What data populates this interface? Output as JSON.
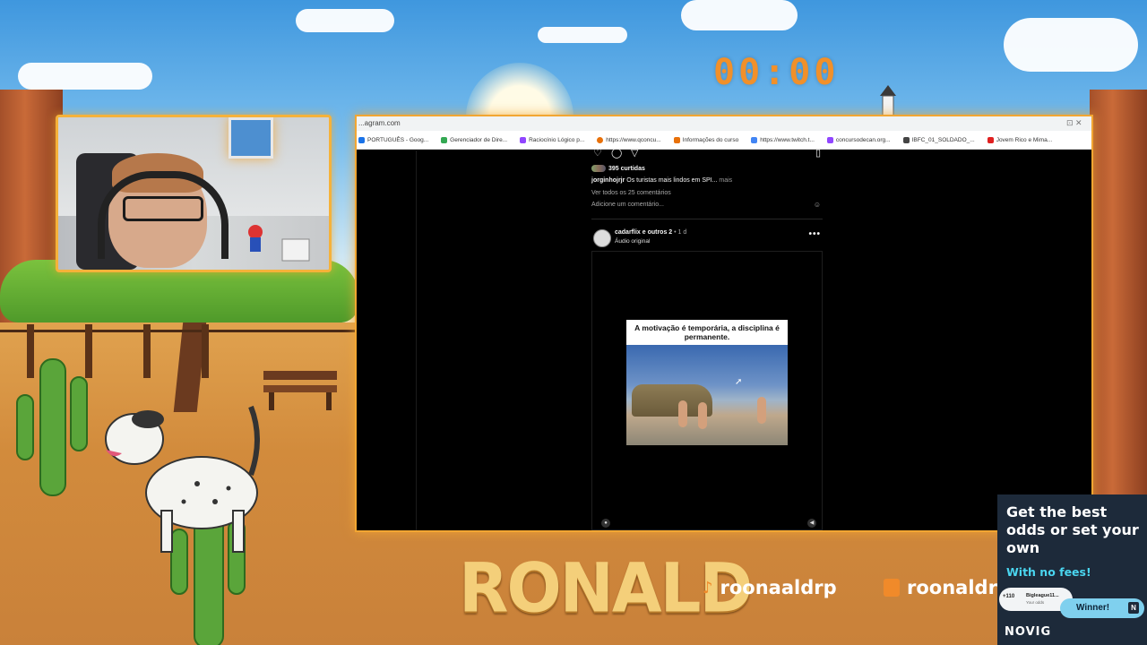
{
  "stream": {
    "timer": "00:00",
    "streamer_name": "RONALD",
    "tiktok_handle": "roonaaldrp",
    "twitch_handle": "roonaldrp"
  },
  "browser": {
    "url": "...agram.com",
    "bookmarks": [
      {
        "label": "PORTUGUÊS - Goog...",
        "color": "#1a73e8"
      },
      {
        "label": "Gerenciador de Dire...",
        "color": "#34a853"
      },
      {
        "label": "Raciocínio Lógico p...",
        "color": "#9146ff"
      },
      {
        "label": "https://www.qconcu...",
        "color": "#e8710a"
      },
      {
        "label": "Informações do curso",
        "color": "#e8710a"
      },
      {
        "label": "https://www.twitch.t...",
        "color": "#4285f4"
      },
      {
        "label": "concursodecan.org...",
        "color": "#9146ff"
      },
      {
        "label": "IBFC_01_SOLDADO_...",
        "color": "#444444"
      },
      {
        "label": "Jovem Rico e Mima...",
        "color": "#202124"
      }
    ]
  },
  "instagram": {
    "likes": "395 curtidas",
    "caption_user": "jorginhojrjr",
    "caption_text": "Os turistas mais lindos em SPI...",
    "caption_more": "mais",
    "view_comments": "Ver todos os 25 comentários",
    "add_comment_placeholder": "Adicione um comentário...",
    "post_user": "cadarflix e outros 2",
    "post_time": "• 1 d",
    "post_audio": "Áudio original",
    "meme_caption": "A motivação é temporária, a disciplina é permanente."
  },
  "ad": {
    "headline": "Get the best odds or set your own",
    "subline": "With no fees!",
    "odds_value": "+110",
    "odds_user": "Bigleague11...",
    "odds_hint": "Your odds",
    "winner_label": "Winner!",
    "brand": "NOVIG"
  },
  "colors": {
    "accent_orange": "#f2a632",
    "timer_orange": "#f1902a",
    "ad_background": "#1d2a3a",
    "ad_accent": "#4ad6f0"
  }
}
